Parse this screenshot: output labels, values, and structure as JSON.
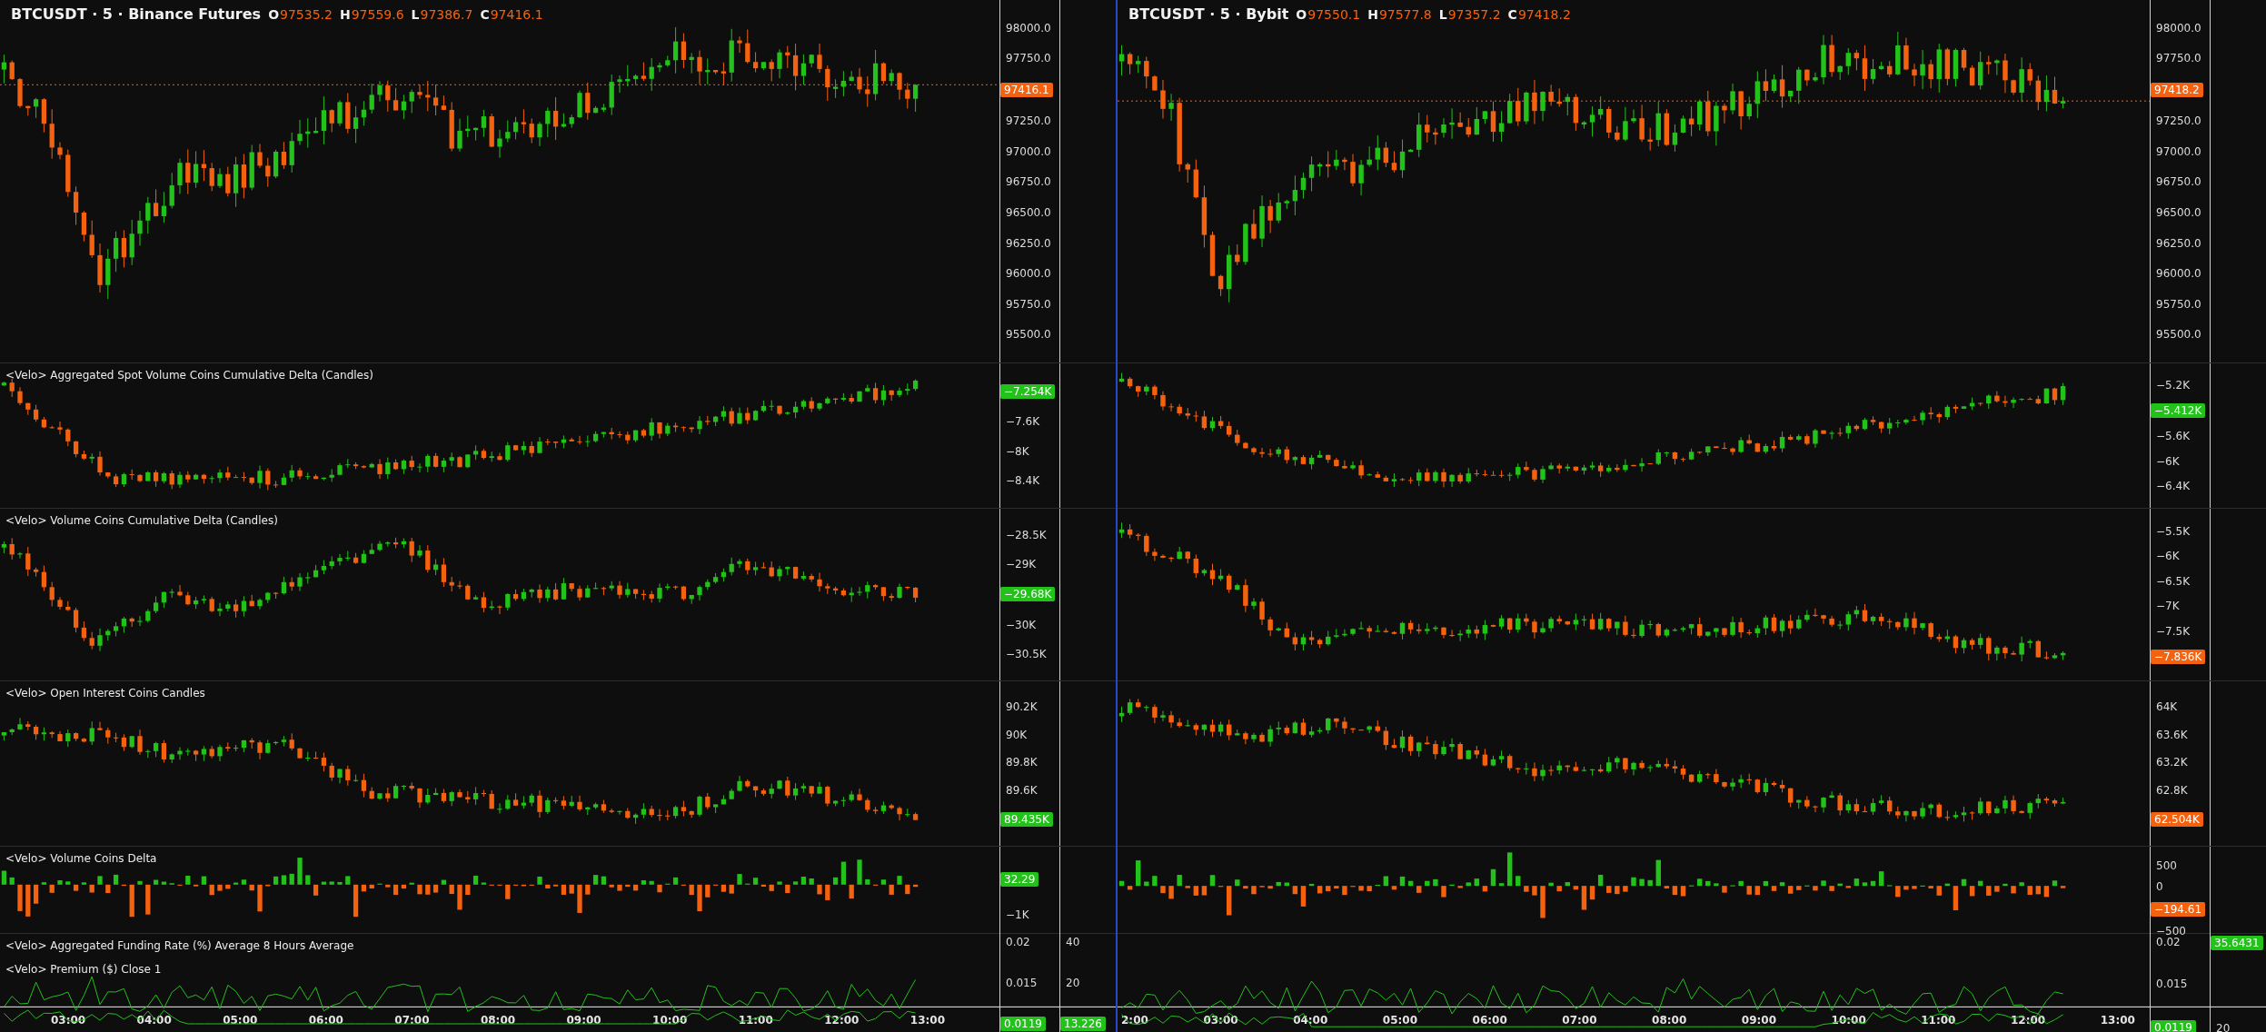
{
  "panels": [
    {
      "header": {
        "symbol": "BTCUSDT · 5 · Binance Futures",
        "color": "#f5620f",
        "ohlc": [
          {
            "label": "O",
            "value": "97535.2"
          },
          {
            "label": "H",
            "value": "97559.6"
          },
          {
            "label": "L",
            "value": "97386.7"
          },
          {
            "label": "C",
            "value": "97416.1"
          }
        ]
      },
      "panes": [
        {
          "kind": "candles",
          "scale": [
            {
              "kind": "tick",
              "text": "98000.0"
            },
            {
              "kind": "tick",
              "text": "97750.0"
            },
            {
              "kind": "badge",
              "text": "97416.1",
              "color": "#f5620f"
            },
            {
              "kind": "tick",
              "text": "97250.0"
            },
            {
              "kind": "tick",
              "text": "97000.0"
            },
            {
              "kind": "tick",
              "text": "96750.0"
            },
            {
              "kind": "tick",
              "text": "96500.0"
            },
            {
              "kind": "tick",
              "text": "96250.0"
            },
            {
              "kind": "tick",
              "text": "96000.0"
            },
            {
              "kind": "tick",
              "text": "95750.0"
            },
            {
              "kind": "tick",
              "text": "95500.0"
            }
          ]
        },
        {
          "kind": "candles",
          "titles": [
            "<Velo> Aggregated Spot Volume Coins Cumulative Delta (Candles)"
          ],
          "scale": [
            {
              "kind": "badge",
              "text": "−7.254K",
              "color": "#22c21a"
            },
            {
              "kind": "tick",
              "text": "−7.6K"
            },
            {
              "kind": "tick",
              "text": "−8K"
            },
            {
              "kind": "tick",
              "text": "−8.4K"
            }
          ]
        },
        {
          "kind": "candles",
          "titles": [
            "<Velo> Volume Coins Cumulative Delta (Candles)"
          ],
          "scale": [
            {
              "kind": "tick",
              "text": "−28.5K"
            },
            {
              "kind": "tick",
              "text": "−29K"
            },
            {
              "kind": "badge",
              "text": "−29.68K",
              "color": "#22c21a"
            },
            {
              "kind": "tick",
              "text": "−30K"
            },
            {
              "kind": "tick",
              "text": "−30.5K"
            }
          ]
        },
        {
          "kind": "candles",
          "titles": [
            "<Velo> Open Interest Coins Candles"
          ],
          "scale": [
            {
              "kind": "tick",
              "text": "90.2K"
            },
            {
              "kind": "tick",
              "text": "90K"
            },
            {
              "kind": "tick",
              "text": "89.8K"
            },
            {
              "kind": "tick",
              "text": "89.6K"
            },
            {
              "kind": "badge",
              "text": "89.435K",
              "color": "#22c21a"
            }
          ]
        },
        {
          "kind": "columns",
          "titles": [
            "<Velo> Volume Coins Delta"
          ],
          "scale": [
            {
              "kind": "badge",
              "text": "32.29",
              "color": "#22c21a"
            },
            {
              "kind": "tick",
              "text": "−1K"
            }
          ]
        },
        {
          "kind": "lines",
          "titles": [
            "<Velo> Aggregated Funding Rate (%) Average 8 Hours Average",
            "<Velo> Premium ($) Close 1"
          ],
          "scale": [
            {
              "kind": "tick",
              "text": "0.02"
            },
            {
              "kind": "tick",
              "text": "0.015"
            },
            {
              "kind": "badge",
              "text": "0.0119",
              "color": "#22c21a"
            }
          ],
          "extra_scale": [
            {
              "kind": "tick",
              "text": "40"
            },
            {
              "kind": "tick",
              "text": "20"
            },
            {
              "kind": "badge",
              "text": "13.226",
              "color": "#22c21a"
            }
          ]
        }
      ],
      "time_axis": [
        "03:00",
        "04:00",
        "05:00",
        "06:00",
        "07:00",
        "08:00",
        "09:00",
        "10:00",
        "11:00",
        "12:00",
        "13:00"
      ]
    },
    {
      "header": {
        "symbol": "BTCUSDT · 5 · Bybit",
        "color": "#f5620f",
        "ohlc": [
          {
            "label": "O",
            "value": "97550.1"
          },
          {
            "label": "H",
            "value": "97577.8"
          },
          {
            "label": "L",
            "value": "97357.2"
          },
          {
            "label": "C",
            "value": "97418.2"
          }
        ]
      },
      "panes": [
        {
          "kind": "candles",
          "scale": [
            {
              "kind": "tick",
              "text": "98000.0"
            },
            {
              "kind": "tick",
              "text": "97750.0"
            },
            {
              "kind": "badge",
              "text": "97418.2",
              "color": "#f5620f"
            },
            {
              "kind": "tick",
              "text": "97250.0"
            },
            {
              "kind": "tick",
              "text": "97000.0"
            },
            {
              "kind": "tick",
              "text": "96750.0"
            },
            {
              "kind": "tick",
              "text": "96500.0"
            },
            {
              "kind": "tick",
              "text": "96250.0"
            },
            {
              "kind": "tick",
              "text": "96000.0"
            },
            {
              "kind": "tick",
              "text": "95750.0"
            },
            {
              "kind": "tick",
              "text": "95500.0"
            }
          ]
        },
        {
          "kind": "candles",
          "scale": [
            {
              "kind": "tick",
              "text": "−5.2K"
            },
            {
              "kind": "badge",
              "text": "−5.412K",
              "color": "#22c21a"
            },
            {
              "kind": "tick",
              "text": "−5.6K"
            },
            {
              "kind": "tick",
              "text": "−6K"
            },
            {
              "kind": "tick",
              "text": "−6.4K"
            }
          ]
        },
        {
          "kind": "candles",
          "scale": [
            {
              "kind": "tick",
              "text": "−5.5K"
            },
            {
              "kind": "tick",
              "text": "−6K"
            },
            {
              "kind": "tick",
              "text": "−6.5K"
            },
            {
              "kind": "tick",
              "text": "−7K"
            },
            {
              "kind": "tick",
              "text": "−7.5K"
            },
            {
              "kind": "badge",
              "text": "−7.836K",
              "color": "#f5620f"
            }
          ]
        },
        {
          "kind": "candles",
          "scale": [
            {
              "kind": "tick",
              "text": "64K"
            },
            {
              "kind": "tick",
              "text": "63.6K"
            },
            {
              "kind": "tick",
              "text": "63.2K"
            },
            {
              "kind": "tick",
              "text": "62.8K"
            },
            {
              "kind": "badge",
              "text": "62.504K",
              "color": "#f5620f"
            }
          ]
        },
        {
          "kind": "columns",
          "scale": [
            {
              "kind": "tick",
              "text": "500"
            },
            {
              "kind": "tick",
              "text": "0"
            },
            {
              "kind": "badge",
              "text": "−194.61",
              "color": "#f5620f"
            },
            {
              "kind": "tick",
              "text": "−500"
            }
          ]
        },
        {
          "kind": "lines",
          "scale": [
            {
              "kind": "tick",
              "text": "0.02"
            },
            {
              "kind": "tick",
              "text": "0.015"
            },
            {
              "kind": "badge",
              "text": "0.0119",
              "color": "#22c21a"
            }
          ],
          "extra_scale": [
            {
              "kind": "badge",
              "text": "35.6431",
              "color": "#22c21a"
            },
            {
              "kind": "tick",
              "text": "20"
            }
          ]
        }
      ],
      "time_axis": [
        "2:00",
        "03:00",
        "04:00",
        "05:00",
        "06:00",
        "07:00",
        "08:00",
        "09:00",
        "10:00",
        "11:00",
        "12:00",
        "13:00"
      ]
    }
  ]
}
